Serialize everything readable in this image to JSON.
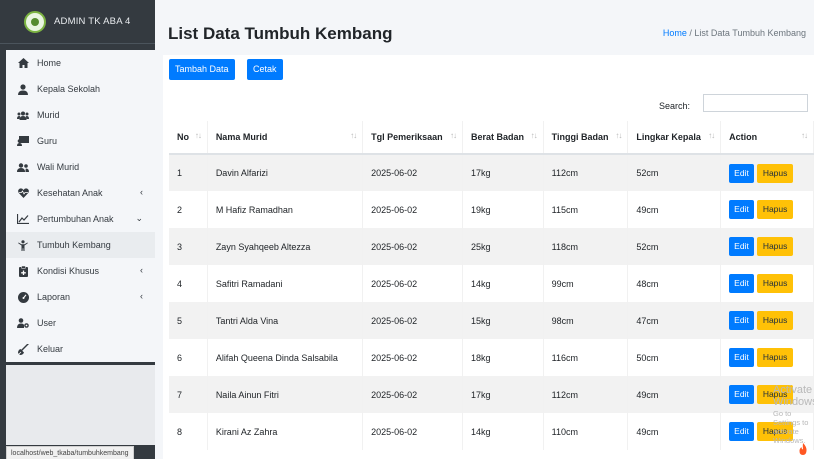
{
  "brand": {
    "title": "ADMIN TK ABA 4"
  },
  "sidebar": {
    "items": [
      {
        "label": "Home",
        "icon": "home-icon"
      },
      {
        "label": "Kepala Sekolah",
        "icon": "user-tie-icon"
      },
      {
        "label": "Murid",
        "icon": "users-icon"
      },
      {
        "label": "Guru",
        "icon": "chalkboard-teacher-icon"
      },
      {
        "label": "Wali Murid",
        "icon": "user-friends-icon"
      },
      {
        "label": "Kesehatan Anak",
        "icon": "heartbeat-icon"
      },
      {
        "label": "Pertumbuhan Anak",
        "icon": "chart-line-icon"
      },
      {
        "label": "Tumbuh Kembang",
        "icon": "child-icon"
      },
      {
        "label": "Kondisi Khusus",
        "icon": "notes-medical-icon"
      },
      {
        "label": "Laporan",
        "icon": "tachometer-icon"
      },
      {
        "label": "User",
        "icon": "user-cog-icon"
      },
      {
        "label": "Keluar",
        "icon": "sign-out-icon"
      }
    ]
  },
  "header": {
    "title": "List Data Tumbuh Kembang",
    "breadcrumb_home": "Home",
    "breadcrumb_sep": "/",
    "breadcrumb_current": "List Data Tumbuh Kembang"
  },
  "toolbar": {
    "tambah_label": "Tambah Data",
    "cetak_label": "Cetak"
  },
  "search": {
    "label": "Search:",
    "value": ""
  },
  "table": {
    "columns": [
      "No",
      "Nama Murid",
      "Tgl Pemeriksaan",
      "Berat Badan",
      "Tinggi Badan",
      "Lingkar Kepala",
      "Action"
    ],
    "edit_label": "Edit",
    "hapus_label": "Hapus",
    "rows": [
      [
        "1",
        "Davin Alfarizi",
        "2025-06-02",
        "17kg",
        "112cm",
        "52cm"
      ],
      [
        "2",
        "M Hafiz Ramadhan",
        "2025-06-02",
        "19kg",
        "115cm",
        "49cm"
      ],
      [
        "3",
        "Zayn Syahqeeb Altezza",
        "2025-06-02",
        "25kg",
        "118cm",
        "52cm"
      ],
      [
        "4",
        "Safitri Ramadani",
        "2025-06-02",
        "14kg",
        "99cm",
        "48cm"
      ],
      [
        "5",
        "Tantri Alda Vina",
        "2025-06-02",
        "15kg",
        "98cm",
        "47cm"
      ],
      [
        "6",
        "Alifah Queena Dinda Salsabila",
        "2025-06-02",
        "18kg",
        "116cm",
        "50cm"
      ],
      [
        "7",
        "Naila Ainun Fitri",
        "2025-06-02",
        "17kg",
        "112cm",
        "49cm"
      ],
      [
        "8",
        "Kirani Az Zahra",
        "2025-06-02",
        "14kg",
        "110cm",
        "49cm"
      ]
    ]
  },
  "status_bar": {
    "url": "localhost/web_tkaba/tumbuhkembang"
  },
  "watermark": {
    "line1": "Activate Windows",
    "line2": "Go to Settings to activate Windows."
  },
  "colors": {
    "primary": "#007bff",
    "warning": "#ffc107",
    "sidebar": "#343a40"
  }
}
